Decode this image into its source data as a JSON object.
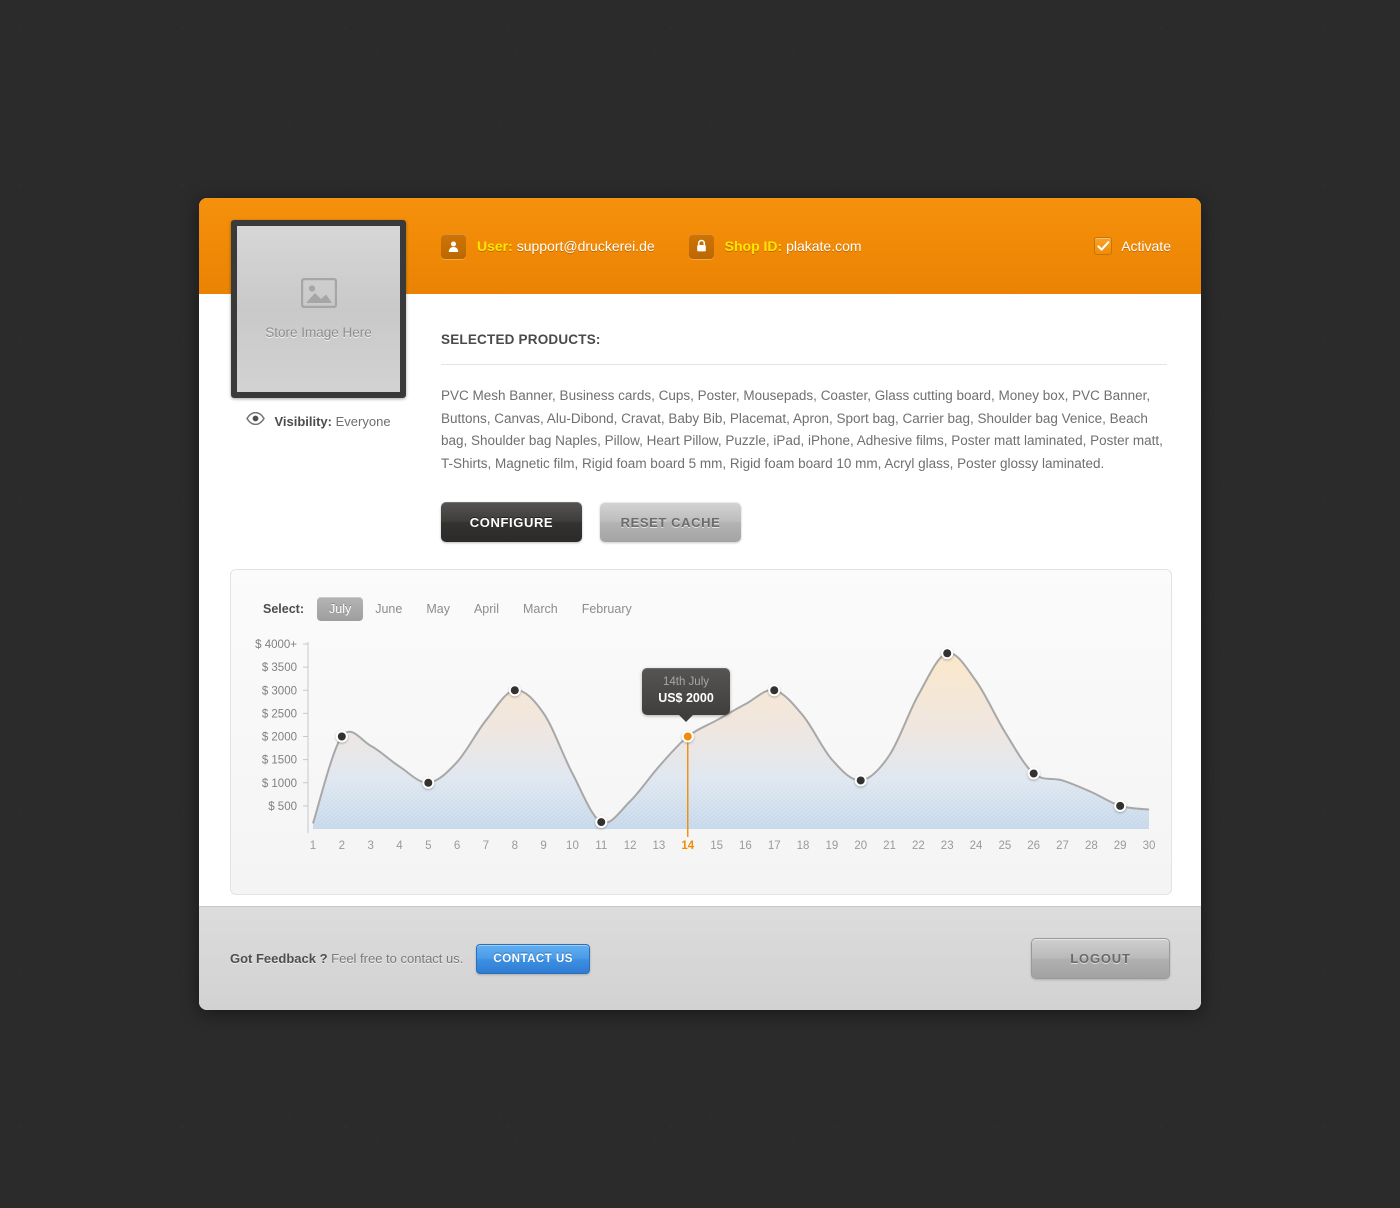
{
  "header": {
    "user_icon": "user-icon",
    "user_key": "User:",
    "user_value": "support@druckerei.de",
    "lock_icon": "lock-icon",
    "shop_key": "Shop ID:",
    "shop_value": "plakate.com",
    "activate_label": "Activate",
    "activate_checked": true,
    "bg_color": "#f08906",
    "accent_yellow": "#ffe600"
  },
  "store_image": {
    "placeholder_label": "Store Image Here",
    "icon": "image-placeholder-icon"
  },
  "visibility": {
    "icon": "eye-icon",
    "key": "Visibility:",
    "value": "Everyone"
  },
  "products": {
    "section_title": "SELECTED PRODUCTS:",
    "list_text": "PVC Mesh Banner, Business cards, Cups, Poster, Mousepads, Coaster, Glass cutting board, Money box, PVC Banner, Buttons, Canvas, Alu-Dibond, Cravat, Baby Bib, Placemat, Apron, Sport bag, Carrier bag, Shoulder bag Venice, Beach bag, Shoulder bag Naples, Pillow, Heart Pillow, Puzzle, iPad, iPhone, Adhesive films, Poster matt laminated, Poster matt, T-Shirts, Magnetic film, Rigid foam board 5 mm, Rigid foam board 10 mm, Acryl glass, Poster glossy laminated."
  },
  "actions": {
    "configure_label": "CONFIGURE",
    "reset_cache_label": "RESET CACHE"
  },
  "chart_panel": {
    "select_label": "Select:",
    "months": [
      {
        "label": "July",
        "active": true
      },
      {
        "label": "June",
        "active": false
      },
      {
        "label": "May",
        "active": false
      },
      {
        "label": "April",
        "active": false
      },
      {
        "label": "March",
        "active": false
      },
      {
        "label": "February",
        "active": false
      }
    ],
    "tooltip": {
      "date": "14th July",
      "value": "US$ 2000"
    }
  },
  "chart_data": {
    "type": "area",
    "title": "",
    "xlabel": "",
    "ylabel": "",
    "ylim": [
      0,
      4000
    ],
    "xlim": [
      1,
      30
    ],
    "grid": false,
    "legend": null,
    "ytick_labels": [
      "$ 4000+",
      "$ 3500",
      "$ 3000",
      "$ 2500",
      "$ 2000",
      "$ 1500",
      "$ 1000",
      "$ 500"
    ],
    "ytick_values": [
      4000,
      3500,
      3000,
      2500,
      2000,
      1500,
      1000,
      500
    ],
    "xtick_labels": [
      "1",
      "2",
      "3",
      "4",
      "5",
      "6",
      "7",
      "8",
      "9",
      "10",
      "11",
      "12",
      "13",
      "14",
      "15",
      "16",
      "17",
      "18",
      "19",
      "20",
      "21",
      "22",
      "23",
      "24",
      "25",
      "26",
      "27",
      "28",
      "29",
      "30"
    ],
    "highlighted_x": 14,
    "highlight_color": "#ef8c09",
    "marker_points": [
      {
        "x": 2,
        "y": 2000
      },
      {
        "x": 5,
        "y": 1000
      },
      {
        "x": 8,
        "y": 3000
      },
      {
        "x": 11,
        "y": 150
      },
      {
        "x": 14,
        "y": 2000,
        "highlighted": true
      },
      {
        "x": 17,
        "y": 3000
      },
      {
        "x": 20,
        "y": 1050
      },
      {
        "x": 23,
        "y": 3800
      },
      {
        "x": 26,
        "y": 1200
      },
      {
        "x": 29,
        "y": 500
      }
    ],
    "x": [
      1,
      2,
      3,
      4,
      5,
      6,
      7,
      8,
      9,
      10,
      11,
      12,
      13,
      14,
      15,
      16,
      17,
      18,
      19,
      20,
      21,
      22,
      23,
      24,
      25,
      26,
      27,
      28,
      29,
      30
    ],
    "values": [
      120,
      2000,
      1800,
      1350,
      1000,
      1450,
      2350,
      3000,
      2500,
      1200,
      150,
      600,
      1350,
      2000,
      2350,
      2700,
      3000,
      2450,
      1500,
      1050,
      1600,
      2900,
      3800,
      3200,
      2100,
      1200,
      1050,
      800,
      500,
      420
    ],
    "area_gradient": {
      "top": "#fbe6c6",
      "bottom": "#c4d7ea"
    },
    "line_color": "#a8a8a8"
  },
  "footer": {
    "feedback_bold": "Got Feedback ?",
    "feedback_rest": " Feel free to contact us.",
    "contact_label": "CONTACT US",
    "logout_label": "LOGOUT",
    "contact_color": "#3d8fe2"
  }
}
